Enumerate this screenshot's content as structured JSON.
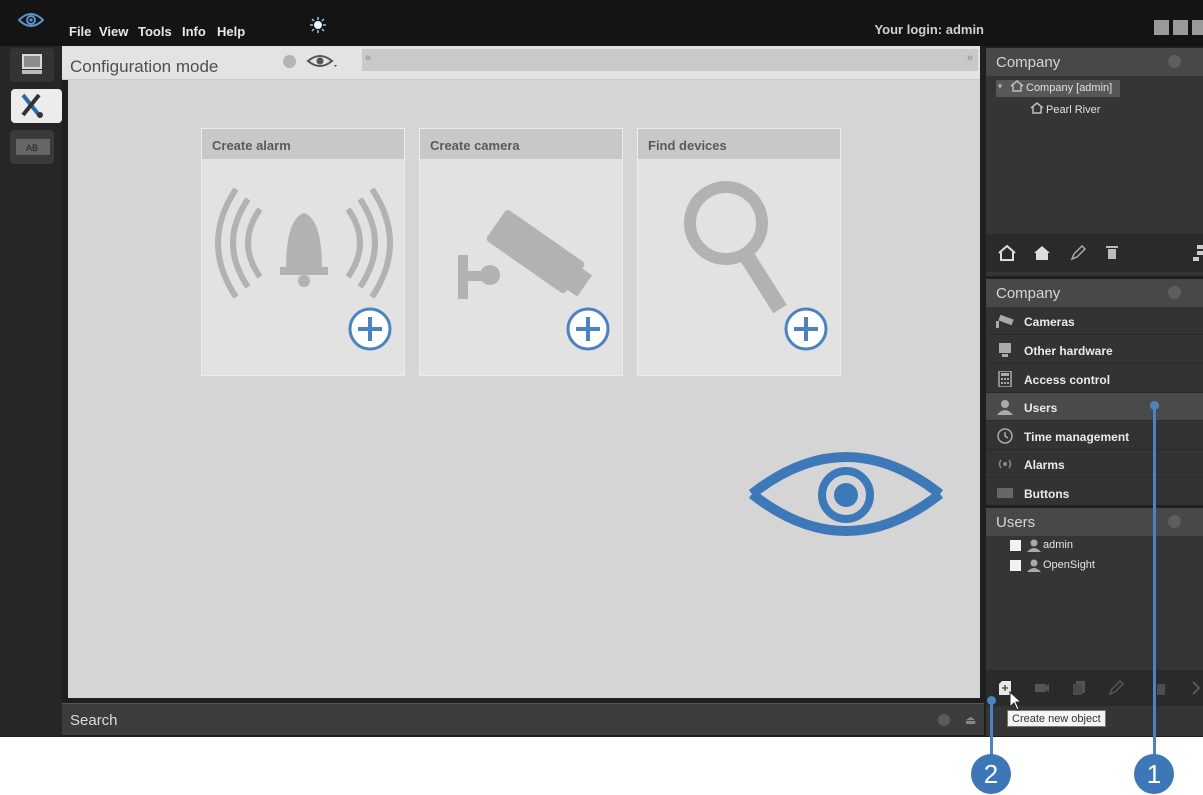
{
  "menu": {
    "file": "File",
    "view": "View",
    "tools": "Tools",
    "info": "Info",
    "help": "Help",
    "login": "Your login: admin"
  },
  "main": {
    "title": "Configuration mode",
    "cards": [
      {
        "label": "Create alarm",
        "icon": "alarm-icon"
      },
      {
        "label": "Create camera",
        "icon": "camera-icon"
      },
      {
        "label": "Find devices",
        "icon": "magnifier-icon"
      }
    ]
  },
  "search": {
    "label": "Search"
  },
  "company_tree": {
    "title": "Company",
    "root": "Company [admin]",
    "child": "Pearl River"
  },
  "categories": {
    "title": "Company",
    "items": [
      {
        "label": "Cameras",
        "icon": "camera-icon"
      },
      {
        "label": "Other hardware",
        "icon": "monitor-icon"
      },
      {
        "label": "Access control",
        "icon": "keypad-icon"
      },
      {
        "label": "Users",
        "icon": "user-icon"
      },
      {
        "label": "Time management",
        "icon": "clock-icon"
      },
      {
        "label": "Alarms",
        "icon": "alarm-icon"
      },
      {
        "label": "Buttons",
        "icon": "button-icon"
      }
    ]
  },
  "users": {
    "title": "Users",
    "items": [
      "admin",
      "OpenSight"
    ]
  },
  "tooltip": "Create new object",
  "callouts": [
    "1",
    "2"
  ],
  "colors": {
    "accent_blue": "#4a83bf",
    "background_dark": "#1f1f1f",
    "panel": "#353535",
    "workspace": "#d5d5d5"
  }
}
